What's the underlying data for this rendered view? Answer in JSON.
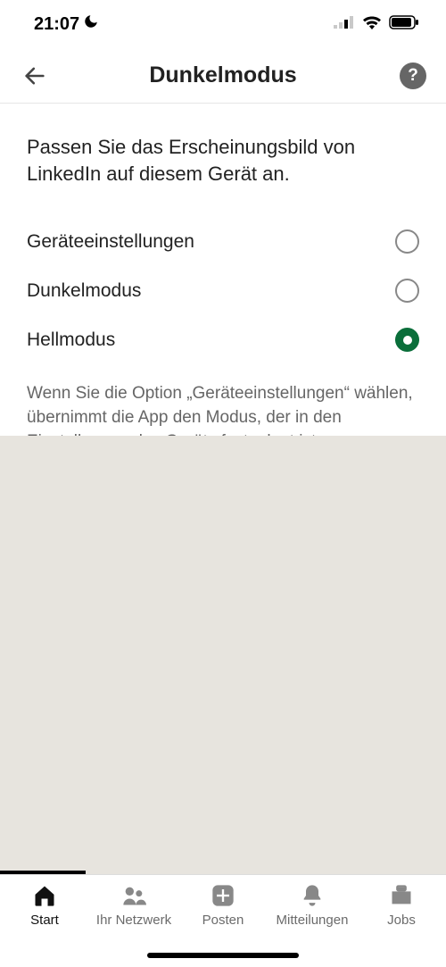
{
  "status": {
    "time": "21:07"
  },
  "header": {
    "title": "Dunkelmodus"
  },
  "content": {
    "intro": "Passen Sie das Erscheinungsbild von LinkedIn auf diesem Gerät an.",
    "options": [
      {
        "label": "Geräteeinstellungen",
        "selected": false
      },
      {
        "label": "Dunkelmodus",
        "selected": false
      },
      {
        "label": "Hellmodus",
        "selected": true
      }
    ],
    "hint": "Wenn Sie die Option „Geräteeinstellungen“ wählen, übernimmt die App den Modus, der in den Einstellungen des Geräts festgelegt ist."
  },
  "bottom": {
    "items": [
      {
        "label": "Start",
        "active": true
      },
      {
        "label": "Ihr Netzwerk",
        "active": false
      },
      {
        "label": "Posten",
        "active": false
      },
      {
        "label": "Mitteilungen",
        "active": false
      },
      {
        "label": "Jobs",
        "active": false
      }
    ]
  }
}
